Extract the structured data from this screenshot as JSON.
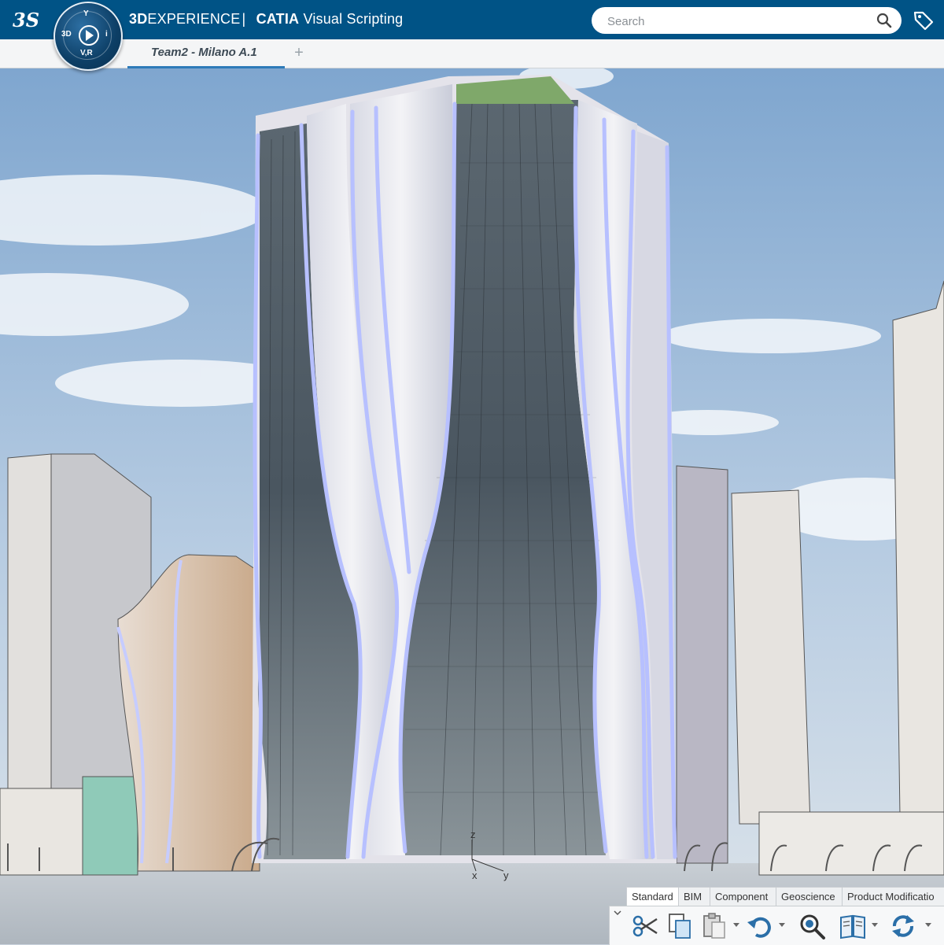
{
  "header": {
    "brand_bold": "3D",
    "brand_rest": "EXPERIENCE",
    "separator": "|",
    "app_bold": "CATIA",
    "app_rest": "Visual Scripting",
    "search_placeholder": "Search",
    "compass": {
      "top": "Y",
      "left": "3D",
      "right": "i",
      "bottom": "V,R"
    }
  },
  "tabs": [
    {
      "label": "Team2 - Milano A.1",
      "active": true
    }
  ],
  "tab_add": "+",
  "toolbar": {
    "sections": [
      {
        "label": "Standard",
        "active": true
      },
      {
        "label": "BIM",
        "active": false
      },
      {
        "label": "Component",
        "active": false
      },
      {
        "label": "Geoscience",
        "active": false
      },
      {
        "label": "Product Modificatio",
        "active": false
      }
    ],
    "tools": [
      "cut-icon",
      "copy-icon",
      "paste-icon",
      "undo-icon",
      "zoom-icon",
      "book-icon",
      "update-icon"
    ]
  },
  "colors": {
    "header_bg": "#005386",
    "tab_underline": "#2d7ab8",
    "sky": "#9fc0e0",
    "tower_light": "#9aa6ff"
  },
  "viewport": {
    "scene": "3D tower rendering",
    "axis_labels": [
      "x",
      "y",
      "z"
    ]
  }
}
